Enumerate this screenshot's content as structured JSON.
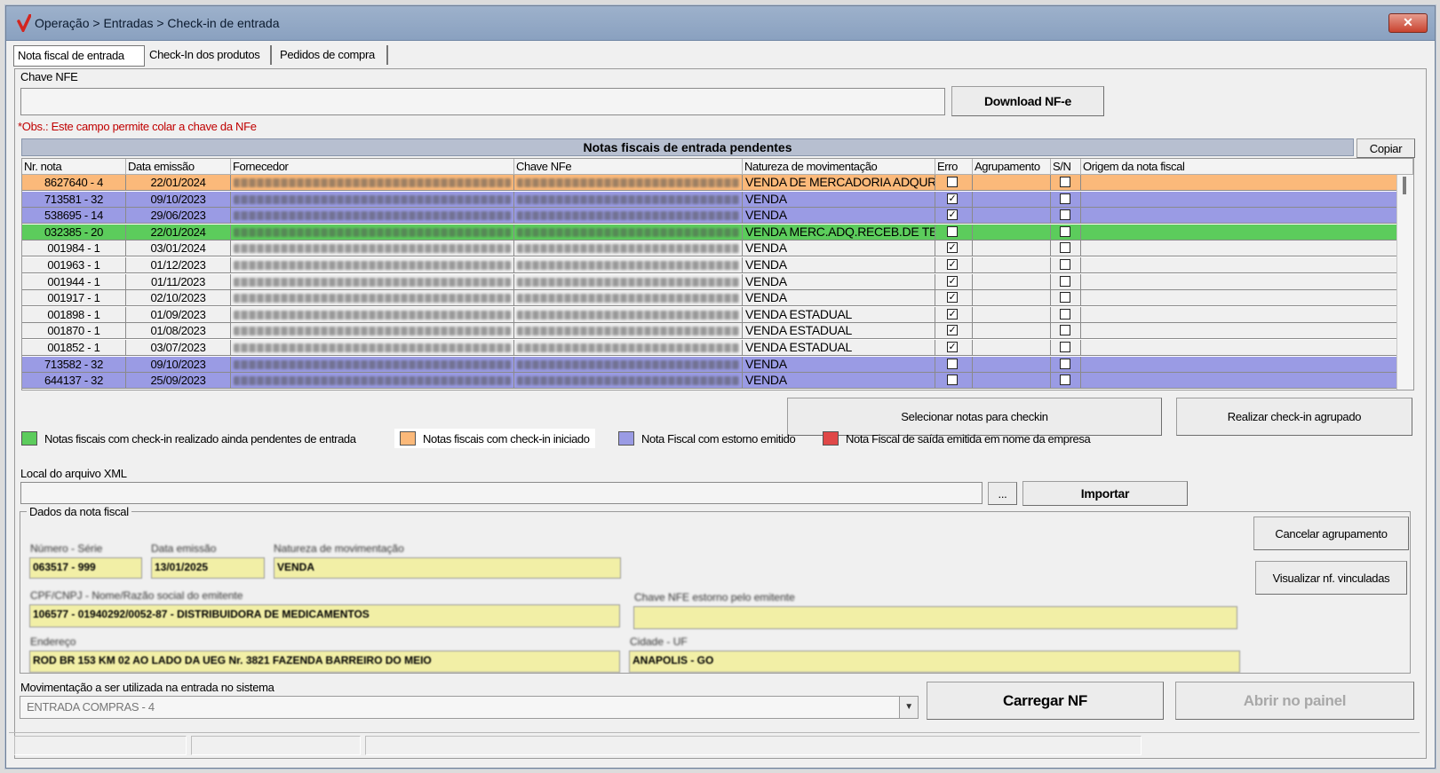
{
  "window": {
    "title": "Operação > Entradas > Check-in de entrada",
    "close_label": "✕"
  },
  "tabs": [
    {
      "label": "Nota fiscal de entrada"
    },
    {
      "label": "Check-In dos produtos"
    },
    {
      "label": "Pedidos de compra"
    }
  ],
  "chave_nfe": {
    "label": "Chave NFE",
    "value": "",
    "obs": "*Obs.: Este campo permite colar a chave da NFe"
  },
  "download_button": "Download NF-e",
  "grid": {
    "title": "Notas fiscais de entrada pendentes",
    "copy_button": "Copiar",
    "columns": [
      "Nr. nota",
      "Data emissão",
      "Fornecedor",
      "Chave NFe",
      "Natureza de movimentação",
      "Erro",
      "Agrupamento",
      "S/N",
      "Origem da nota fiscal"
    ],
    "rows": [
      {
        "nota": "8627640 - 4",
        "data": "22/01/2024",
        "natureza": "VENDA DE MERCADORIA ADQURI",
        "erro": false,
        "sn": false,
        "color": "#fbb97a"
      },
      {
        "nota": "713581 - 32",
        "data": "09/10/2023",
        "natureza": "VENDA",
        "erro": true,
        "sn": false,
        "color": "#9a9be4"
      },
      {
        "nota": "538695 - 14",
        "data": "29/06/2023",
        "natureza": "VENDA",
        "erro": true,
        "sn": false,
        "color": "#9a9be4"
      },
      {
        "nota": "032385 - 20",
        "data": "22/01/2024",
        "natureza": "VENDA MERC.ADQ.RECEB.DE TEF",
        "erro": false,
        "sn": false,
        "color": "#5ccc5c"
      },
      {
        "nota": "001984 - 1",
        "data": "03/01/2024",
        "natureza": "VENDA",
        "erro": true,
        "sn": false,
        "color": "#f0f0f0"
      },
      {
        "nota": "001963 - 1",
        "data": "01/12/2023",
        "natureza": "VENDA",
        "erro": true,
        "sn": false,
        "color": "#f0f0f0"
      },
      {
        "nota": "001944 - 1",
        "data": "01/11/2023",
        "natureza": "VENDA",
        "erro": true,
        "sn": false,
        "color": "#f0f0f0"
      },
      {
        "nota": "001917 - 1",
        "data": "02/10/2023",
        "natureza": "VENDA",
        "erro": true,
        "sn": false,
        "color": "#f0f0f0"
      },
      {
        "nota": "001898 - 1",
        "data": "01/09/2023",
        "natureza": "VENDA ESTADUAL",
        "erro": true,
        "sn": false,
        "color": "#f0f0f0"
      },
      {
        "nota": "001870 - 1",
        "data": "01/08/2023",
        "natureza": "VENDA ESTADUAL",
        "erro": true,
        "sn": false,
        "color": "#f0f0f0"
      },
      {
        "nota": "001852 - 1",
        "data": "03/07/2023",
        "natureza": "VENDA ESTADUAL",
        "erro": true,
        "sn": false,
        "color": "#f0f0f0"
      },
      {
        "nota": "713582 - 32",
        "data": "09/10/2023",
        "natureza": "VENDA",
        "erro": false,
        "sn": false,
        "color": "#9a9be4"
      },
      {
        "nota": "644137 - 32",
        "data": "25/09/2023",
        "natureza": "VENDA",
        "erro": false,
        "sn": false,
        "color": "#9a9be4"
      }
    ]
  },
  "actions": {
    "select_notes": "Selecionar notas para checkin",
    "grouped_checkin": "Realizar check-in agrupado"
  },
  "legend": [
    {
      "label": "Notas fiscais com check-in realizado ainda pendentes de entrada",
      "color": "#5ccc5c"
    },
    {
      "label": "Notas fiscais com check-in iniciado",
      "color": "#fbb97a"
    },
    {
      "label": "Nota Fiscal com estorno emitido",
      "color": "#9a9be4"
    },
    {
      "label": "Nota Fiscal de saída emitida em nome da empresa",
      "color": "#e04848"
    }
  ],
  "xml": {
    "label": "Local do arquivo XML",
    "value": "",
    "browse": "...",
    "import": "Importar"
  },
  "dados": {
    "title": "Dados da nota fiscal",
    "cancel_group": "Cancelar agrupamento",
    "view_linked": "Visualizar nf. vinculadas",
    "numero_label": "Número - Série",
    "numero": "063517 - 999",
    "emissao_label": "Data emissão",
    "emissao": "13/01/2025",
    "natureza_label": "Natureza de movimentação",
    "natureza": "VENDA",
    "emitente_label": "CPF/CNPJ - Nome/Razão social do emitente",
    "emitente": "106577 - 01940292/0052-87 - DISTRIBUIDORA DE MEDICAMENTOS",
    "chave_estorno_label": "Chave NFE estorno pelo emitente",
    "chave_estorno": "",
    "endereco_label": "Endereço",
    "endereco": "ROD BR 153 KM 02 AO LADO DA UEG Nr. 3821 FAZENDA BARREIRO DO MEIO",
    "cidade_label": "Cidade - UF",
    "cidade": "ANAPOLIS - GO"
  },
  "movimentacao": {
    "label": "Movimentação a ser utilizada na entrada no sistema",
    "value": "ENTRADA COMPRAS - 4"
  },
  "carregar_nf": "Carregar NF",
  "abrir_painel": "Abrir no painel"
}
